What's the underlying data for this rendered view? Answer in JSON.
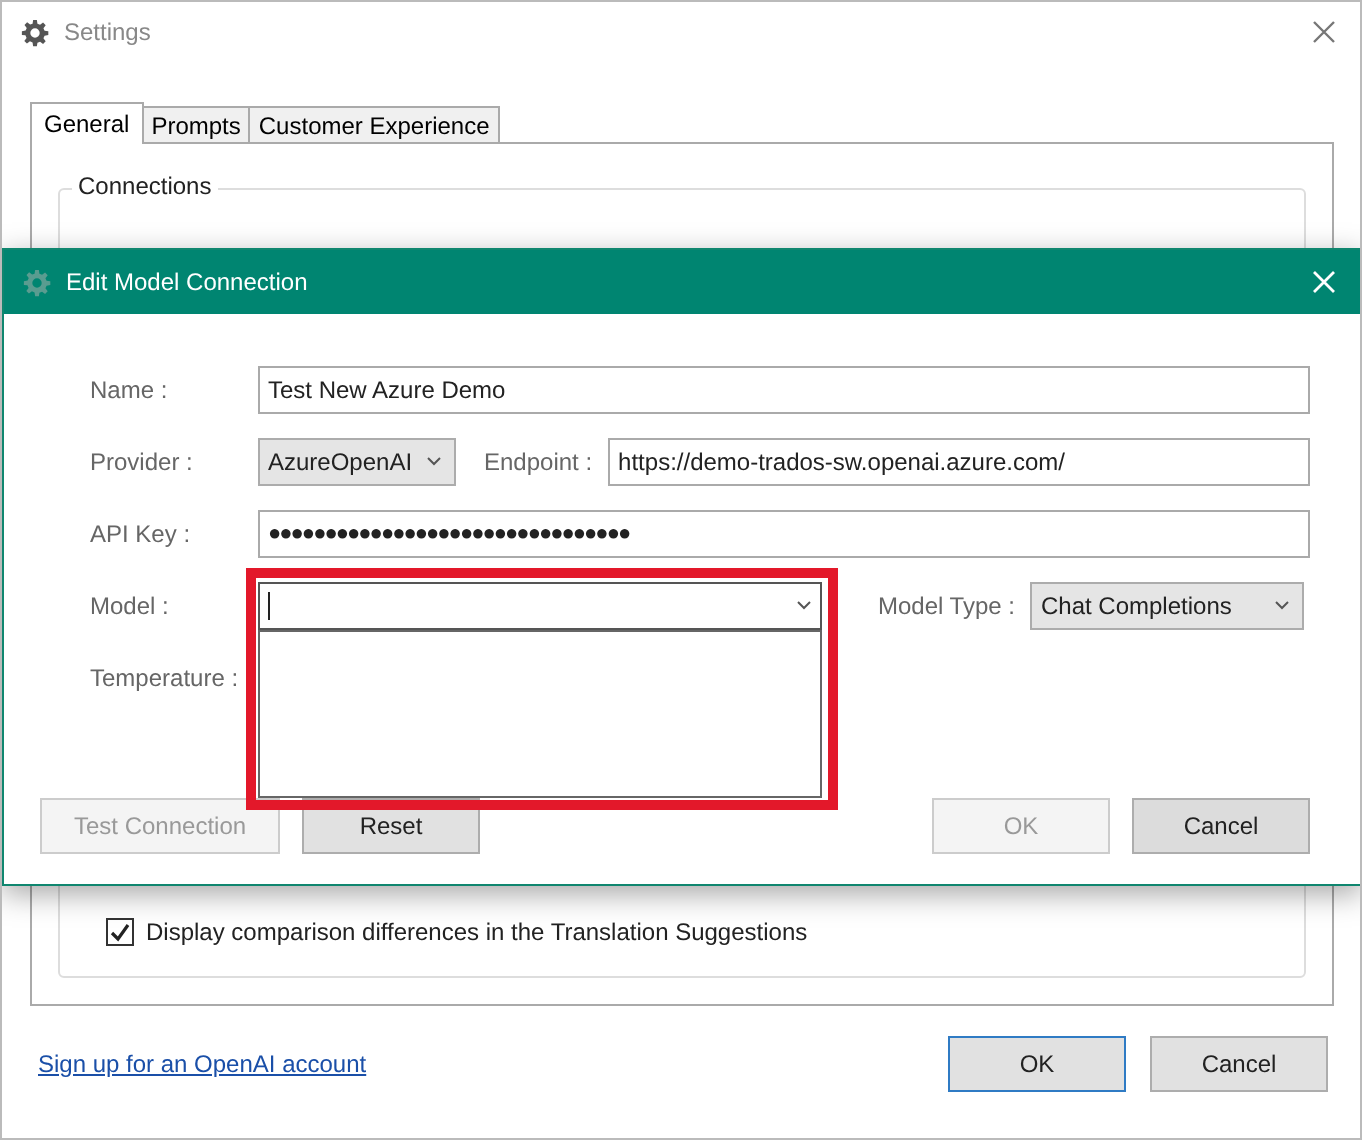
{
  "settings": {
    "title": "Settings",
    "tabs": [
      {
        "label": "General",
        "selected": true
      },
      {
        "label": "Prompts",
        "selected": false
      },
      {
        "label": "Customer Experience",
        "selected": false
      }
    ],
    "group_title": "Connections",
    "option": {
      "label": "Display comparison differences in the Translation Suggestions",
      "checked": true
    },
    "link": "Sign up for an OpenAI account",
    "buttons": [
      {
        "label": "OK",
        "default": true
      },
      {
        "label": "Cancel",
        "default": false
      }
    ]
  },
  "dialog": {
    "title": "Edit Model Connection",
    "name": {
      "label": "Name :",
      "value": "Test New Azure Demo"
    },
    "provider": {
      "label": "Provider :",
      "value": "AzureOpenAI"
    },
    "endpoint": {
      "label": "Endpoint :",
      "value": "https://demo-trados-sw.openai.azure.com/"
    },
    "api_key": {
      "label": "API Key :",
      "value": "●●●●●●●●●●●●●●●●●●●●●●●●●●●●●●●●"
    },
    "model": {
      "label": "Model :",
      "expanded": true,
      "highlighted": true
    },
    "model_type": {
      "label": "Model Type :",
      "value": "Chat Completions"
    },
    "temperature": {
      "label": "Temperature :"
    },
    "buttons": [
      {
        "label": "Test Connection",
        "disabled": true
      },
      {
        "label": "Reset",
        "disabled": false
      },
      {
        "label": "OK",
        "disabled": true
      },
      {
        "label": "Cancel",
        "disabled": false
      }
    ]
  }
}
